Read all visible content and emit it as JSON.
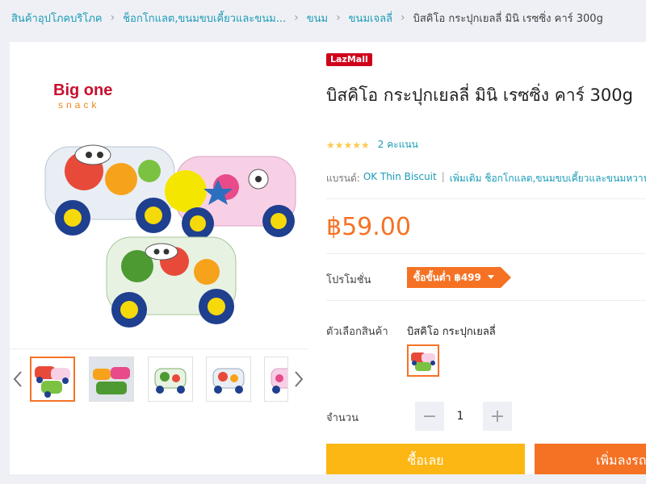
{
  "breadcrumb": {
    "items": [
      "สินค้าอุปโภคบริโภค",
      "ช็อกโกแลต,ขนมขบเคี้ยวและขนม...",
      "ขนม",
      "ขนมเจลลี่"
    ],
    "current": "บิสคิโอ กระปุกเยลลี่ มินิ เรซซิ่ง คาร์ 300g"
  },
  "gallery": {
    "brand_logo_top": "Big one",
    "brand_logo_bottom": "snack",
    "thumb_count": 6
  },
  "product": {
    "badge": "LazMall",
    "title": "บิสคิโอ กระปุกเยลลี่ มินิ เรซซิ่ง คาร์ 300g",
    "stars": "★★★★★",
    "rating_count": "2 คะแนน",
    "brand_label": "แบรนด์:",
    "brand_name": "OK Thin Biscuit",
    "brand_sep": "|",
    "more_label": "เพิ่มเติม ช็อกโกแลต,ขนมขบเคี้ยวและขนมหวาน",
    "price": "฿59.00"
  },
  "promotion": {
    "label": "โปรโมชั่น",
    "tag": "ซื้อขั้นต่ำ ฿499"
  },
  "variant": {
    "label": "ตัวเลือกสินค้า",
    "name": "บิสคิโอ กระปุกเยลลี่"
  },
  "quantity": {
    "label": "จำนวน",
    "minus": "−",
    "value": "1",
    "plus": "+"
  },
  "actions": {
    "buy_now": "ซื้อเลย",
    "add_to_cart": "เพิ่มลงรถเข็น"
  },
  "colors": {
    "accent": "#f57224",
    "buy": "#fcb714",
    "link": "#1a9cb7",
    "lazmall": "#d0011b",
    "star": "#faca51"
  }
}
